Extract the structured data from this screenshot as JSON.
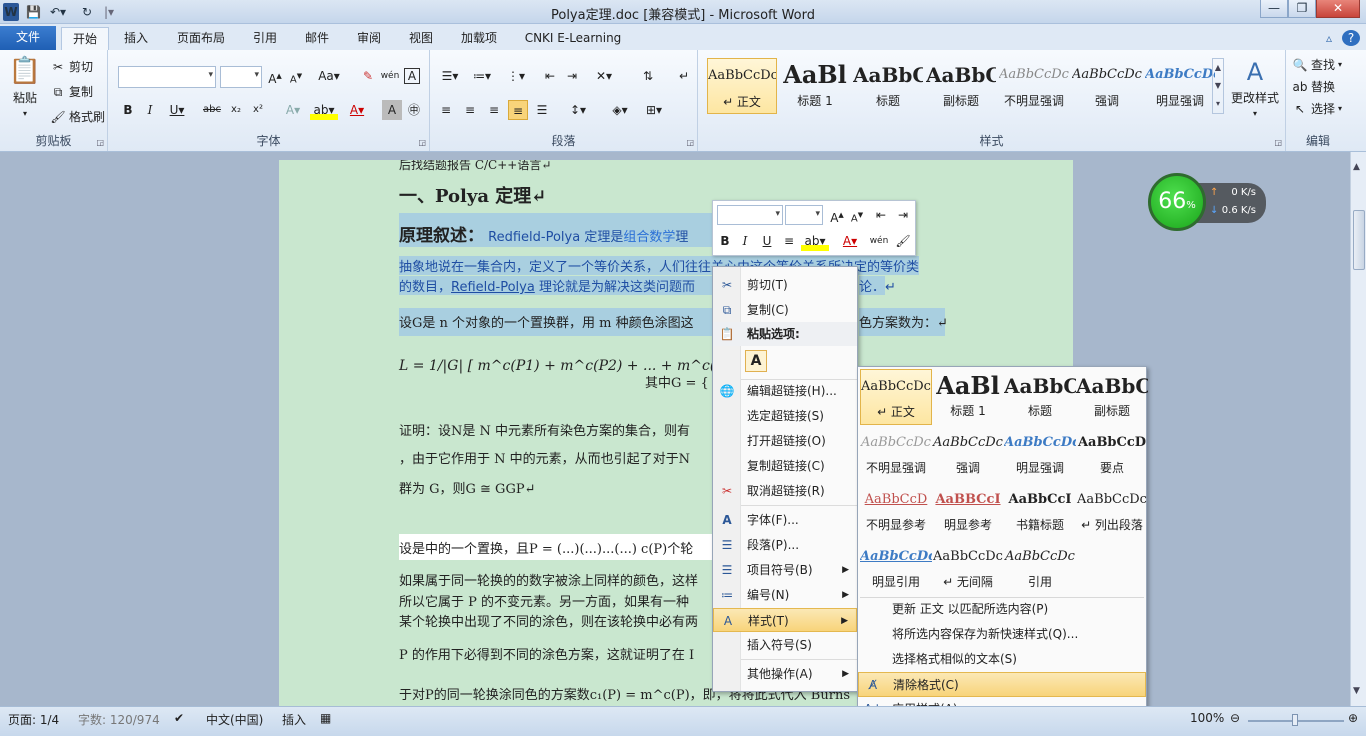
{
  "title_bar": {
    "title": "Polya定理.doc [兼容模式]  -  Microsoft Word",
    "app_icon": "W",
    "min": "—",
    "max": "❐",
    "close": "✕"
  },
  "tabs": [
    "文件",
    "开始",
    "插入",
    "页面布局",
    "引用",
    "邮件",
    "审阅",
    "视图",
    "加载项",
    "CNKI E-Learning"
  ],
  "ribbon": {
    "clipboard": {
      "label": "剪贴板",
      "paste": "粘贴",
      "cut": "剪切",
      "copy": "复制",
      "format_painter": "格式刷"
    },
    "font": {
      "label": "字体"
    },
    "paragraph": {
      "label": "段落"
    },
    "styles": {
      "label": "样式",
      "items": [
        {
          "preview": "AaBbCcDc",
          "name": "↵ 正文"
        },
        {
          "preview": "AaBl",
          "name": "标题 1"
        },
        {
          "preview": "AaBbC",
          "name": "标题"
        },
        {
          "preview": "AaBbC",
          "name": "副标题"
        },
        {
          "preview": "AaBbCcDc",
          "name": "不明显强调"
        },
        {
          "preview": "AaBbCcDc",
          "name": "强调"
        },
        {
          "preview": "AaBbCcDc",
          "name": "明显强调"
        }
      ],
      "change": "更改样式"
    },
    "editing": {
      "label": "编辑",
      "find": "查找",
      "replace": "替换",
      "select": "选择"
    }
  },
  "document": {
    "line0": "后找结题报告 C/C++语言↵",
    "heading": "一、Polya 定理↵",
    "principle_label": "原理叙述：",
    "principle_text_a": "Redfield-Polya 定理是",
    "principle_link": "组合数学",
    "principle_text_b": "理",
    "para1_line1": "抽象地说在一集合内，定义了一个等价关系，人们往往关心由这个等价关系所决定的等价类",
    "para1_line2_a": "的数目，",
    "para1_line2_link": "Refield-Polya",
    "para1_line2_b": " 理论就是为解决这类问题而",
    "para1_line2_c": "论．↵",
    "para2_a": "设G是 n 个对象的一个置换群，用 m 种颜色涂图这",
    "para2_b": "色方案数为：↵",
    "formula": "L = 1/|G| [ m^c(P1) + m^c(P2) + ... + m^c(Pg) ]",
    "formula_tail": "其中G = {",
    "proof_line1": "证明：设N是 N 中元素所有染色方案的集合，则有",
    "proof_line2": "，由于它作用于 N 中的元素，从而也引起了对于N",
    "proof_line3": "群为 G，则G ≅ GGP↵",
    "perm_line": "设是中的一个置换，且P = (...)(...)...(...)  c(P)个轮",
    "para3_line1": "如果属于同一轮换的的数字被涂上同样的颜色，这样",
    "para3_line2": "所以它属于 P 的不变元素。另一方面，如果有一种",
    "para3_line3": "某个轮换中出现了不同的涂色，则在该轮换中必有两",
    "para4": "P 的作用下必得到不同的涂色方案，这就证明了在 I",
    "para5": "于对P的同一轮换涂同色的方案数c₁(P) = m^c(P)，即，将将此式代入 Burns"
  },
  "mini_toolbar": {
    "bold": "B",
    "italic": "I",
    "underline": "U"
  },
  "context_menu": {
    "cut": "剪切(T)",
    "copy": "复制(C)",
    "paste_options": "粘贴选项:",
    "paste_keep": "A",
    "edit_link": "编辑超链接(H)...",
    "select_link": "选定超链接(S)",
    "open_link": "打开超链接(O)",
    "copy_link": "复制超链接(C)",
    "remove_link": "取消超链接(R)",
    "font": "字体(F)...",
    "paragraph": "段落(P)...",
    "bullets": "项目符号(B)",
    "numbering": "编号(N)",
    "styles": "样式(T)",
    "insert_symbol": "插入符号(S)",
    "other_actions": "其他操作(A)"
  },
  "styles_submenu": {
    "gallery": [
      {
        "preview": "AaBbCcDc",
        "name": "↵ 正文"
      },
      {
        "preview": "AaBl",
        "name": "标题 1"
      },
      {
        "preview": "AaBbC",
        "name": "标题"
      },
      {
        "preview": "AaBbC",
        "name": "副标题"
      },
      {
        "preview": "AaBbCcDc",
        "name": "不明显强调"
      },
      {
        "preview": "AaBbCcDc",
        "name": "强调"
      },
      {
        "preview": "AaBbCcDc",
        "name": "明显强调"
      },
      {
        "preview": "AaBbCcD",
        "name": "要点"
      },
      {
        "preview": "AaBbCcD",
        "name": "不明显参考"
      },
      {
        "preview": "AaBBCcI",
        "name": "明显参考"
      },
      {
        "preview": "AaBbCcI",
        "name": "书籍标题"
      },
      {
        "preview": "AaBbCcDc",
        "name": "↵ 列出段落"
      },
      {
        "preview": "AaBbCcDc",
        "name": "明显引用"
      },
      {
        "preview": "AaBbCcDc",
        "name": "↵ 无间隔"
      },
      {
        "preview": "AaBbCcDc",
        "name": "引用"
      }
    ],
    "update": "更新 正文 以匹配所选内容(P)",
    "save_new": "将所选内容保存为新快速样式(Q)...",
    "select_similar": "选择格式相似的文本(S)",
    "clear": "清除格式(C)",
    "apply": "应用样式(A)..."
  },
  "net_widget": {
    "percent": "66",
    "percent_sign": "%",
    "up": "0 K/s",
    "down": "0.6 K/s"
  },
  "status_bar": {
    "page": "页面: 1/4",
    "words": "字数: 120/974",
    "language": "中文(中国)",
    "insert": "插入",
    "zoom": "100%"
  }
}
